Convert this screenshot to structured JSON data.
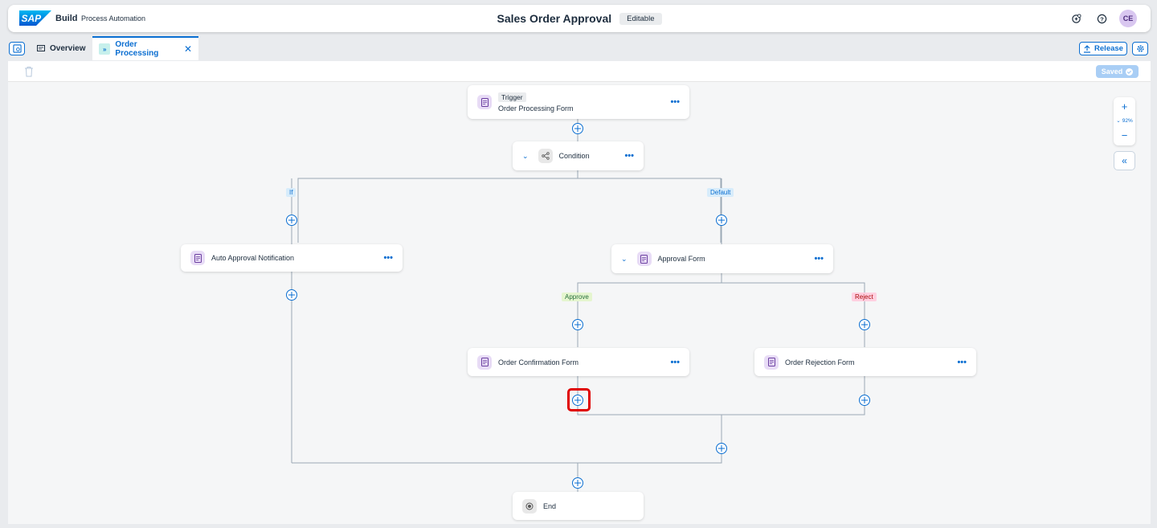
{
  "shell": {
    "logo_text": "SAP",
    "product": "Build",
    "product_sub": "Process Automation",
    "title": "Sales Order Approval",
    "badge": "Editable",
    "avatar": "CE",
    "icons": [
      "notification-assist-icon",
      "help-icon"
    ]
  },
  "tabs": {
    "overview": "Overview",
    "active": "Order Processing",
    "release": "Release"
  },
  "toolbar": {
    "saved": "Saved"
  },
  "zoom": {
    "level": "92%"
  },
  "nodes": {
    "trigger_tag": "Trigger",
    "trigger": "Order Processing Form",
    "condition": "Condition",
    "auto_approval": "Auto Approval Notification",
    "approval_form": "Approval Form",
    "order_confirmation": "Order Confirmation Form",
    "order_rejection": "Order Rejection Form",
    "end": "End"
  },
  "branches": {
    "if": "If",
    "default": "Default",
    "approve": "Approve",
    "reject": "Reject"
  },
  "colors": {
    "accent": "#0a6ed1",
    "highlight": "#e00000"
  }
}
